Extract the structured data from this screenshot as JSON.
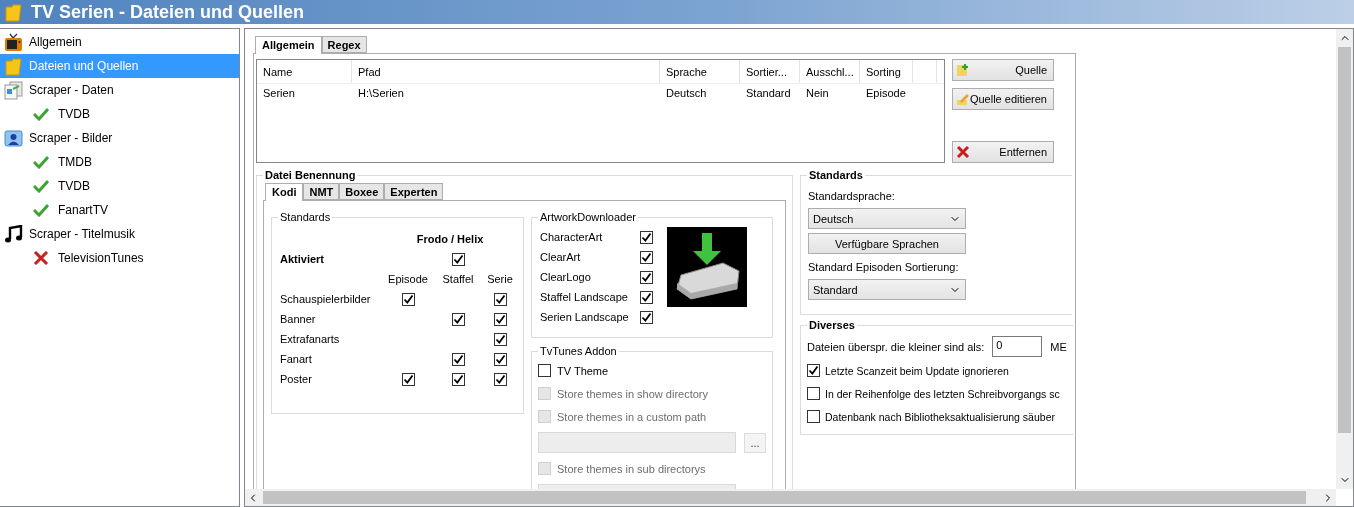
{
  "window": {
    "title": "TV Serien - Dateien und Quellen"
  },
  "sidebar": {
    "items": [
      {
        "label": "Allgemein",
        "kind": "tv",
        "selected": false
      },
      {
        "label": "Dateien und Quellen",
        "kind": "folder",
        "selected": true
      },
      {
        "label": "Scraper - Daten",
        "kind": "data",
        "selected": false,
        "children": [
          {
            "label": "TVDB",
            "enabled": true,
            "selected": false
          }
        ]
      },
      {
        "label": "Scraper - Bilder",
        "kind": "images",
        "selected": false,
        "children": [
          {
            "label": "TMDB",
            "enabled": true,
            "selected": false
          },
          {
            "label": "TVDB",
            "enabled": true,
            "selected": false
          },
          {
            "label": "FanartTV",
            "enabled": true,
            "selected": false
          }
        ]
      },
      {
        "label": "Scraper - Titelmusik",
        "kind": "music",
        "selected": false,
        "children": [
          {
            "label": "TelevisionTunes",
            "enabled": false,
            "selected": false
          }
        ]
      }
    ]
  },
  "tabs": [
    {
      "label": "Allgemein",
      "selected": true
    },
    {
      "label": "Regex",
      "selected": false
    }
  ],
  "sources": {
    "columns": [
      "Name",
      "Pfad",
      "Sprache",
      "Sortier...",
      "Ausschl...",
      "Sorting"
    ],
    "rows": [
      [
        "Serien",
        "H:\\Serien",
        "Deutsch",
        "Standard",
        "Nein",
        "Episode"
      ]
    ]
  },
  "source_buttons": [
    {
      "label": "Quelle",
      "kind": "add"
    },
    {
      "label": "Quelle editieren",
      "kind": "edit"
    },
    {
      "label": "Entfernen",
      "kind": "remove"
    }
  ],
  "naming": {
    "title": "Datei Benennung",
    "tabs": [
      {
        "label": "Kodi",
        "selected": true
      },
      {
        "label": "NMT",
        "selected": false
      },
      {
        "label": "Boxee",
        "selected": false
      },
      {
        "label": "Experten",
        "selected": false
      }
    ],
    "standards": {
      "title": "Standards",
      "version": "Frodo / Helix",
      "activated": {
        "label": "Aktiviert",
        "checked": true
      },
      "columns": [
        "Episode",
        "Staffel",
        "Serie"
      ],
      "rows": [
        {
          "label": "Schauspielerbilder",
          "episode": true,
          "serie": true
        },
        {
          "label": "Banner",
          "staffel": true,
          "serie": true
        },
        {
          "label": "Extrafanarts",
          "serie": true
        },
        {
          "label": "Fanart",
          "staffel": true,
          "serie": true
        },
        {
          "label": "Poster",
          "episode": true,
          "staffel": true,
          "serie": true
        }
      ]
    },
    "artwork": {
      "title": "ArtworkDownloader",
      "items": [
        {
          "label": "CharacterArt",
          "checked": true
        },
        {
          "label": "ClearArt",
          "checked": true
        },
        {
          "label": "ClearLogo",
          "checked": true
        },
        {
          "label": "Staffel Landscape",
          "checked": true
        },
        {
          "label": "Serien Landscape",
          "checked": true
        }
      ]
    },
    "tvtunes": {
      "title": "TvTunes Addon",
      "items": [
        {
          "kind": "checkbox",
          "label": "TV Theme",
          "checked": false,
          "disabled": false
        },
        {
          "kind": "checkbox",
          "label": "Store themes in show directory",
          "checked": false,
          "disabled": true
        },
        {
          "kind": "checkbox",
          "label": "Store themes in a custom path",
          "checked": false,
          "disabled": true
        },
        {
          "kind": "path",
          "disabled": true,
          "button": "..."
        },
        {
          "kind": "checkbox",
          "label": "Store themes in sub directorys",
          "checked": false,
          "disabled": true
        },
        {
          "kind": "path",
          "disabled": true
        }
      ]
    }
  },
  "defaults": {
    "title": "Standards",
    "language_label": "Standardsprache:",
    "language": "Deutsch",
    "languages_button": "Verfügbare Sprachen",
    "sort_label": "Standard Episoden Sortierung:",
    "sort": "Standard"
  },
  "misc": {
    "title": "Diverses",
    "size_label": "Dateien überspr. die kleiner sind als:",
    "size_value": "0",
    "size_unit": "ME",
    "options": [
      {
        "label": "Letzte Scanzeit beim Update ignorieren",
        "checked": true
      },
      {
        "label": "In der Reihenfolge des letzten Schreibvorgangs sc",
        "checked": false
      },
      {
        "label": "Datenbank nach Bibliotheksaktualisierung säuber",
        "checked": false
      }
    ]
  }
}
